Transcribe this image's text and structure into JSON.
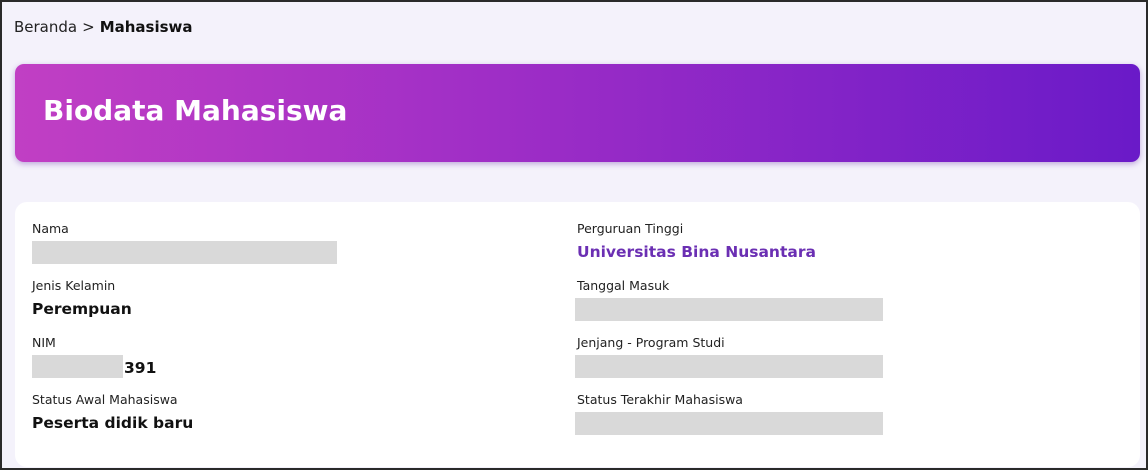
{
  "breadcrumb": {
    "home": "Beranda",
    "separator": ">",
    "current": "Mahasiswa"
  },
  "banner": {
    "title": "Biodata Mahasiswa"
  },
  "left_fields": {
    "nama": {
      "label": "Nama"
    },
    "jenis_kelamin": {
      "label": "Jenis Kelamin",
      "value": "Perempuan"
    },
    "nim": {
      "label": "NIM",
      "value_suffix": "391"
    },
    "status_awal": {
      "label": "Status Awal Mahasiswa",
      "value": "Peserta didik baru"
    }
  },
  "right_fields": {
    "perguruan_tinggi": {
      "label": "Perguruan Tinggi",
      "value": "Universitas Bina Nusantara"
    },
    "tanggal_masuk": {
      "label": "Tanggal Masuk"
    },
    "jenjang_prodi": {
      "label": "Jenjang - Program Studi"
    },
    "status_terakhir": {
      "label": "Status Terakhir Mahasiswa"
    }
  },
  "colors": {
    "banner_start": "#c13fc4",
    "banner_end": "#6a1ac8",
    "accent_text": "#6b2fb3",
    "redaction": "#d9d9d9",
    "background": "#f4f2fb"
  }
}
